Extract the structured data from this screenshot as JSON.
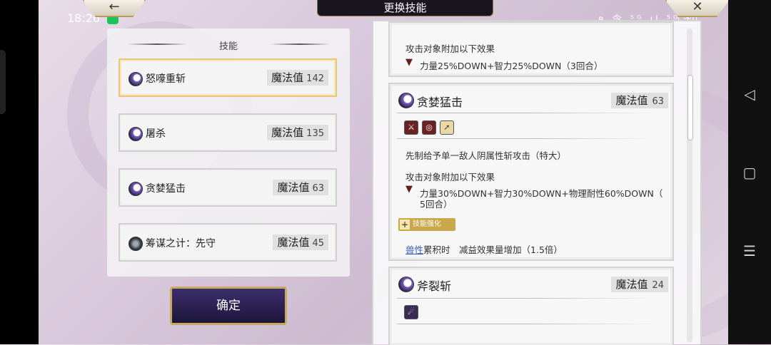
{
  "status_bar": {
    "time": "18:26",
    "icons": "ʙ 令 ⁵ᴳ.ıl ⁵ᴳ.ıl",
    "battery": "60"
  },
  "top_bar": {
    "title": "更换技能",
    "back_icon": "←",
    "close_icon": "✕"
  },
  "left_panel": {
    "heading": "技能",
    "skills": [
      {
        "name": "怒嚎重斩",
        "mp_label": "魔法值",
        "mp": "142",
        "selected": true
      },
      {
        "name": "屠杀",
        "mp_label": "魔法值",
        "mp": "135",
        "selected": false
      },
      {
        "name": "贪婪猛击",
        "mp_label": "魔法值",
        "mp": "63",
        "selected": false
      },
      {
        "name": "筹谋之计：先守",
        "mp_label": "魔法值",
        "mp": "45",
        "selected": false
      }
    ],
    "confirm_label": "确定"
  },
  "right_panel": {
    "card0": {
      "line1": "攻击对象附加以下效果",
      "line2": "力量25%DOWN+智力25%DOWN（3回合）"
    },
    "card1": {
      "name": "贪婪猛击",
      "mp_label": "魔法值",
      "mp": "63",
      "desc1": "先制给予单一敌人阴属性斩攻击（特大）",
      "desc2": "攻击对象附加以下效果",
      "desc3a": "力量30%DOWN+智力30%DOWN+物理耐性60%DOWN（",
      "desc3b": "5回合）",
      "enhance_label": "技能强化",
      "enhance_link": "兽性",
      "enhance_text": "累积时　减益效果量增加（1.5倍）"
    },
    "card2": {
      "name": "斧裂斩",
      "mp_label": "魔法值",
      "mp": "24"
    }
  },
  "nav": {
    "back": "◁",
    "home": "▢",
    "menu": "☰"
  }
}
